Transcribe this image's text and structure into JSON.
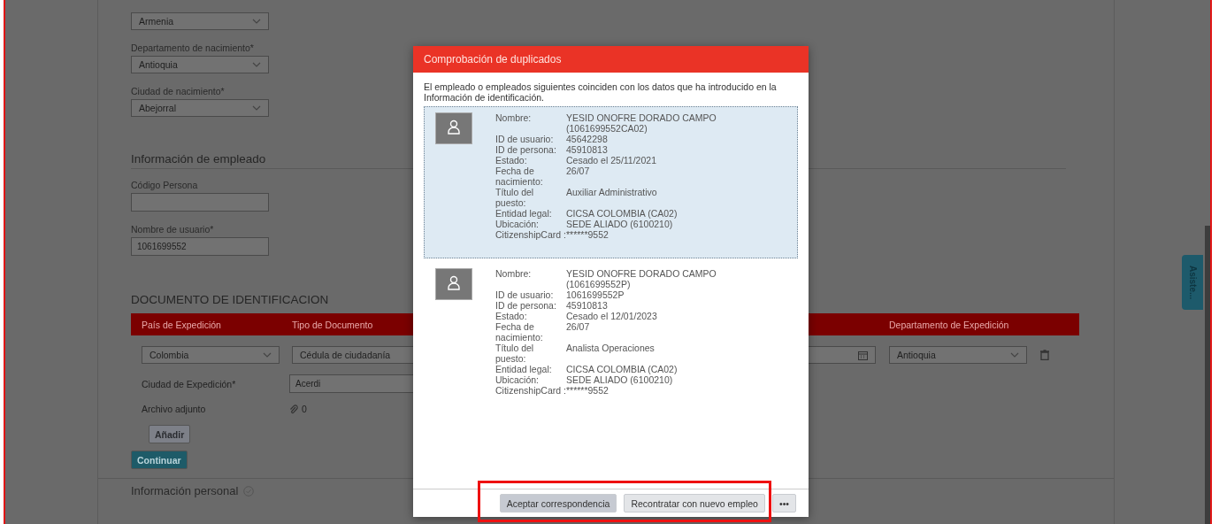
{
  "birth_fields": [
    {
      "value": "Armenia"
    },
    {
      "label": "Departamento de nacimiento*",
      "value": "Antioquia"
    },
    {
      "label": "Ciudad de nacimiento*",
      "value": "Abejorral"
    }
  ],
  "employee_section": {
    "title": "Información de empleado",
    "fields": [
      {
        "label": "Código Persona"
      },
      {
        "label": "Nombre de usuario*",
        "value": "1061699552"
      }
    ]
  },
  "document_section": {
    "title": "DOCUMENTO DE IDENTIFICACION",
    "columns": [
      "País de Expedición",
      "Tipo de Documento",
      "",
      "Departamento de Expedición"
    ],
    "row": {
      "country": "Colombia",
      "doc_type": "Cédula de ciudadanía",
      "department": "Antioquia"
    },
    "city": {
      "label": "Ciudad de Expedición*",
      "value": "Acerdi"
    },
    "attachment": {
      "label": "Archivo adjunto",
      "count": "0"
    },
    "add_button": "Añadir"
  },
  "continue_button": "Continuar",
  "next_section": {
    "title": "Información personal",
    "done": true
  },
  "assistant_tab": "Asiste...",
  "dialog": {
    "title": "Comprobación de duplicados",
    "intro": "El empleado o empleados siguientes coinciden con los datos que ha introducido en la Información de identificación.",
    "matches": [
      {
        "selected": true,
        "fields": [
          {
            "label": "Nombre:",
            "value": "YESID ONOFRE DORADO CAMPO (1061699552CA02)"
          },
          {
            "label": "ID de usuario:",
            "value": "45642298"
          },
          {
            "label": "ID de persona:",
            "value": "45910813"
          },
          {
            "label": "Estado:",
            "value": "Cesado el 25/11/2021"
          },
          {
            "label": "Fecha de nacimiento:",
            "value": "26/07"
          },
          {
            "label": "Título del puesto:",
            "value": "Auxiliar Administrativo"
          },
          {
            "label": "Entidad legal:",
            "value": "CICSA COLOMBIA (CA02)"
          },
          {
            "label": "Ubicación:",
            "value": "SEDE ALIADO (6100210)"
          },
          {
            "label": "CitizenshipCard :",
            "value": "******9552"
          }
        ]
      },
      {
        "selected": false,
        "fields": [
          {
            "label": "Nombre:",
            "value": "YESID ONOFRE DORADO CAMPO (1061699552P)"
          },
          {
            "label": "ID de usuario:",
            "value": "1061699552P"
          },
          {
            "label": "ID de persona:",
            "value": "45910813"
          },
          {
            "label": "Estado:",
            "value": "Cesado el 12/01/2023"
          },
          {
            "label": "Fecha de nacimiento:",
            "value": "26/07"
          },
          {
            "label": "Título del puesto:",
            "value": "Analista Operaciones"
          },
          {
            "label": "Entidad legal:",
            "value": "CICSA COLOMBIA (CA02)"
          },
          {
            "label": "Ubicación:",
            "value": "SEDE ALIADO (6100210)"
          },
          {
            "label": "CitizenshipCard :",
            "value": "******9552"
          }
        ]
      }
    ],
    "actions": [
      "Aceptar correspondencia",
      "Recontratar con nuevo empleo"
    ],
    "more": "•••",
    "highlighted": true
  }
}
